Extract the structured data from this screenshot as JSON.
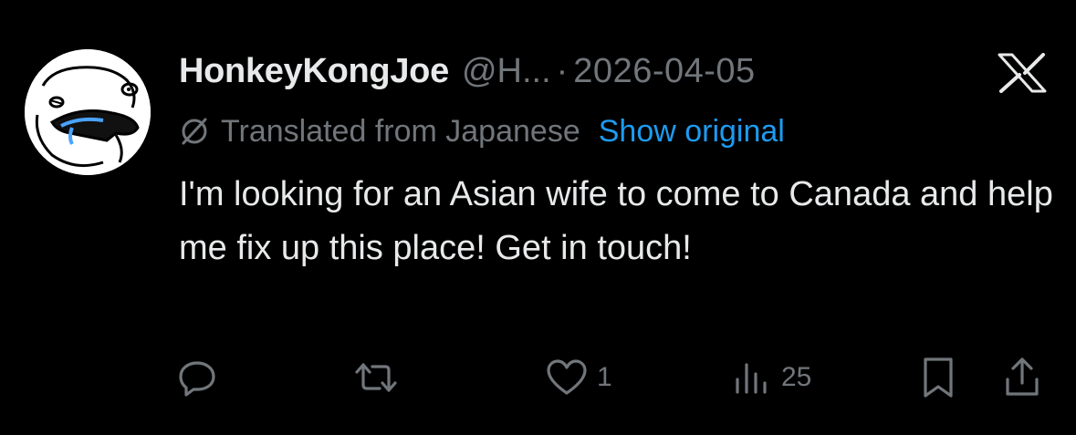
{
  "tweet": {
    "display_name": "HonkeyKongJoe",
    "handle": "@H...",
    "separator": "·",
    "date": "2026-04-05",
    "translation_label": "Translated from Japanese",
    "show_original_label": "Show original",
    "text": "I'm looking for an Asian wife to come to Canada and help me fix up this place! Get in touch!"
  },
  "actions": {
    "reply_count": "",
    "repost_count": "",
    "like_count": "1",
    "views_count": "25"
  },
  "icons": {
    "platform_logo": "x-logo-icon",
    "translate": "translate-icon",
    "reply": "reply-icon",
    "repost": "repost-icon",
    "like": "heart-icon",
    "views": "views-chart-icon",
    "bookmark": "bookmark-icon",
    "share": "share-icon"
  },
  "colors": {
    "background": "#000000",
    "text_primary": "#e7e9ea",
    "text_secondary": "#71767b",
    "link_accent": "#1d9bf0"
  }
}
